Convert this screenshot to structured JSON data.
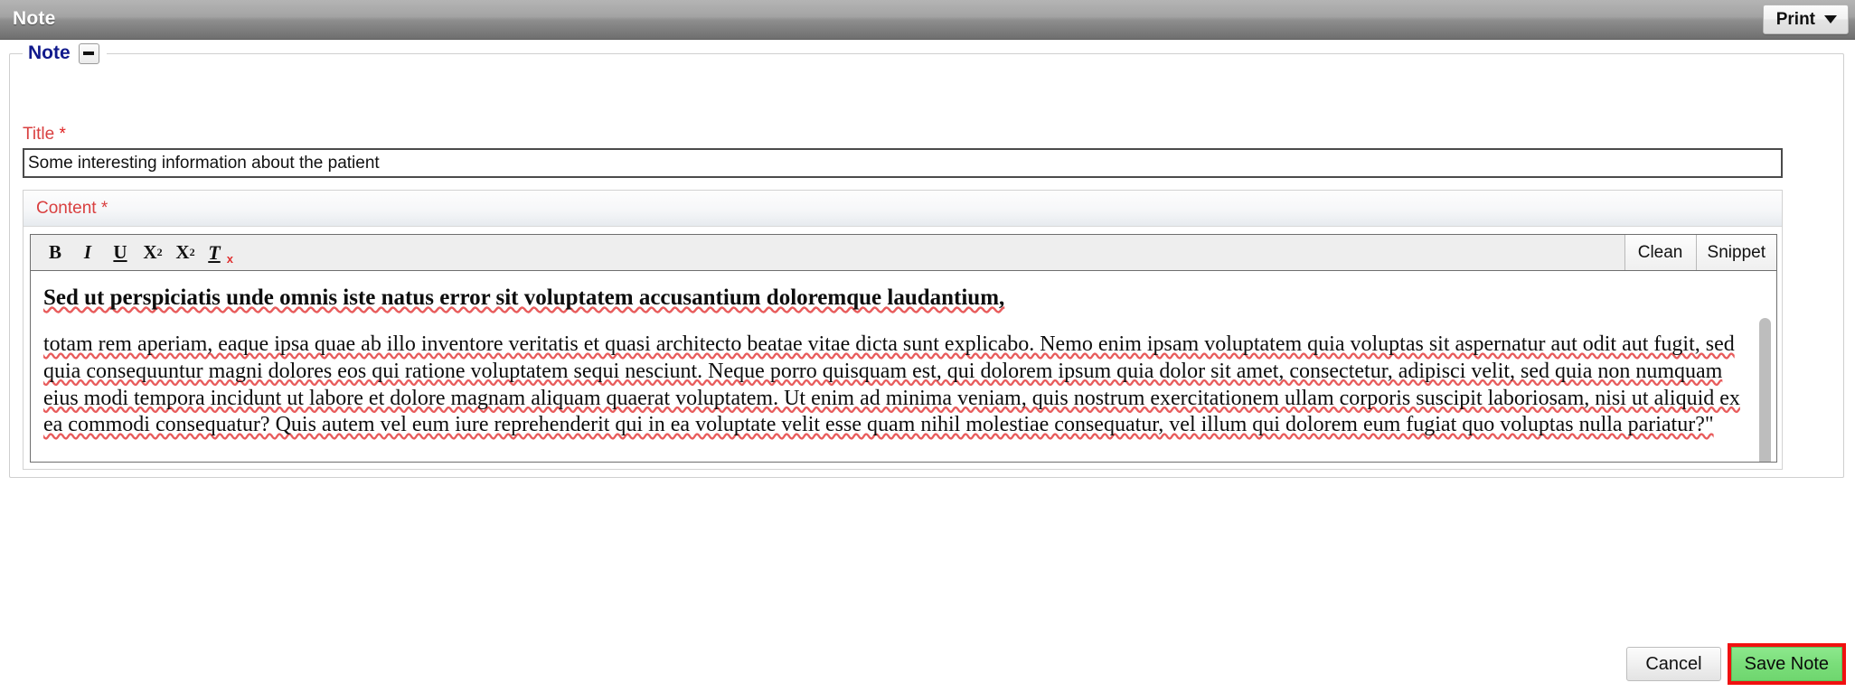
{
  "titlebar": {
    "title": "Note",
    "print_label": "Print",
    "print_caret_icon": "chevron-down-icon"
  },
  "note_section": {
    "legend": "Note",
    "collapse_icon": "minus-icon"
  },
  "title_field": {
    "label": "Title",
    "required_marker": "*",
    "value": "Some interesting information about the patient",
    "placeholder": ""
  },
  "content_field": {
    "label": "Content",
    "required_marker": "*"
  },
  "editor": {
    "toolbar": {
      "bold": "B",
      "italic": "I",
      "underline": "U",
      "subscript_base": "X",
      "subscript_mark": "2",
      "superscript_base": "X",
      "superscript_mark": "2",
      "remove_format_base": "T",
      "remove_format_mark": "x",
      "clean_label": "Clean",
      "snippet_label": "Snippet"
    },
    "document": {
      "heading": "Sed ut perspiciatis unde omnis iste natus error sit voluptatem accusantium doloremque laudantium,",
      "body": "totam rem aperiam, eaque ipsa quae ab illo inventore veritatis et quasi architecto beatae vitae dicta sunt explicabo. Nemo enim ipsam voluptatem quia voluptas sit aspernatur aut odit aut fugit, sed quia consequuntur magni dolores eos qui ratione voluptatem sequi nesciunt. Neque porro quisquam est, qui dolorem ipsum quia dolor sit amet, consectetur, adipisci velit, sed quia non numquam eius modi tempora incidunt ut labore et dolore magnam aliquam quaerat voluptatem. Ut enim ad minima veniam, quis nostrum exercitationem ullam corporis suscipit laboriosam, nisi ut aliquid ex ea commodi consequatur? Quis autem vel eum iure reprehenderit qui in ea voluptate velit esse quam nihil molestiae consequatur, vel illum qui dolorem eum fugiat quo voluptas nulla pariatur?\""
    }
  },
  "footer": {
    "cancel_label": "Cancel",
    "save_label": "Save Note",
    "save_highlight_color": "#f01010",
    "save_background_color": "#7ade7a"
  }
}
